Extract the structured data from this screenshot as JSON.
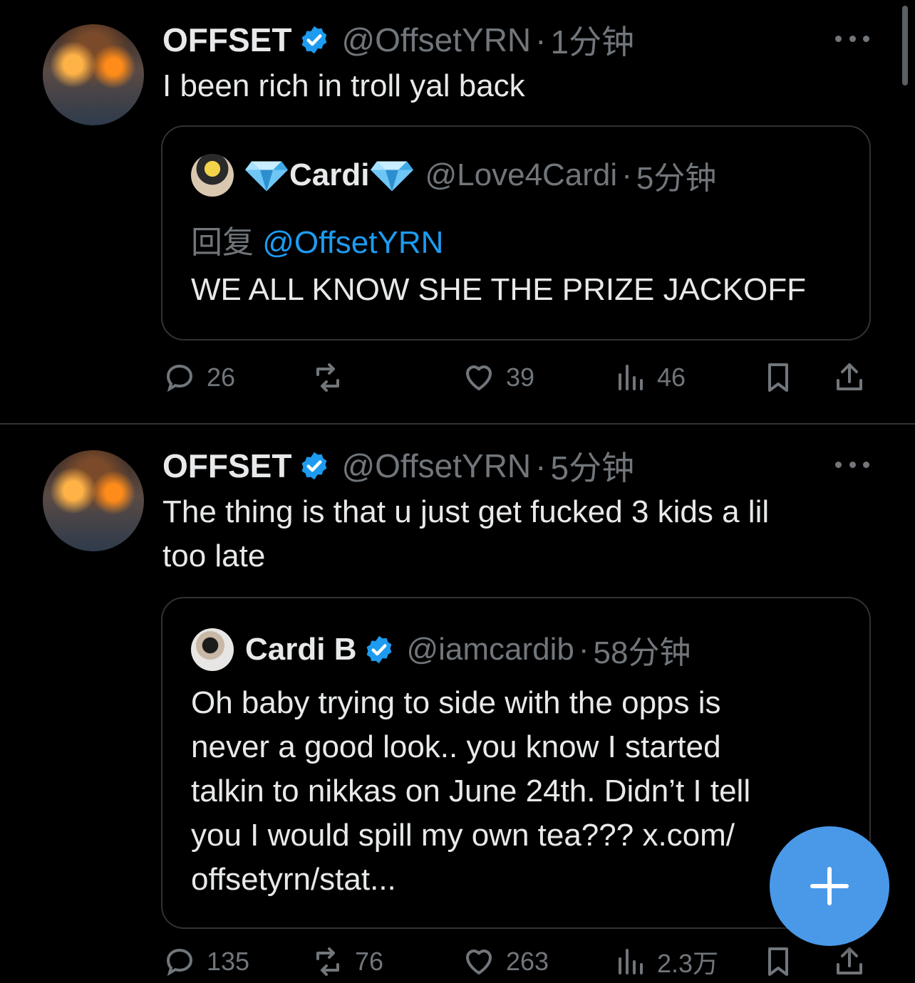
{
  "tweets": [
    {
      "name": "OFFSET",
      "handle": "@OffsetYRN",
      "sep": "·",
      "time": "1分钟",
      "text": "I been rich in troll yal back",
      "quote": {
        "name": "Cardi",
        "handle": "@Love4Cardi",
        "sep": "·",
        "time": "5分钟",
        "reply_prefix": "回复",
        "reply_to": "@OffsetYRN",
        "text": "WE ALL KNOW SHE THE PRIZE JACKOFF"
      },
      "actions": {
        "replies": "26",
        "reposts": "",
        "likes": "39",
        "views": "46"
      }
    },
    {
      "name": "OFFSET",
      "handle": "@OffsetYRN",
      "sep": "·",
      "time": "5分钟",
      "text_lines": [
        "The thing is that u just get fucked 3 kids a lil",
        "too late"
      ],
      "quote": {
        "name": "Cardi B",
        "handle": "@iamcardib",
        "sep": "·",
        "time": "58分钟",
        "text_lines": [
          "Oh baby trying to side with the opps is",
          "never a good look.. you know I started",
          "talkin to nikkas on June 24th. Didn’t I tell",
          "you I would spill my own tea??? x.com/",
          "offsetyrn/stat..."
        ]
      },
      "actions": {
        "replies": "135",
        "reposts": "76",
        "likes": "263",
        "views": "2.3万"
      }
    }
  ],
  "colors": {
    "background": "#000000",
    "text": "#e7e9ea",
    "muted": "#71767b",
    "link": "#1d9bf0",
    "fab": "#4a99e9"
  },
  "icons": [
    "verified-badge-icon",
    "more-icon",
    "reply-icon",
    "repost-icon",
    "like-icon",
    "views-icon",
    "bookmark-icon",
    "share-icon",
    "compose-plus-icon",
    "gem-icon"
  ]
}
